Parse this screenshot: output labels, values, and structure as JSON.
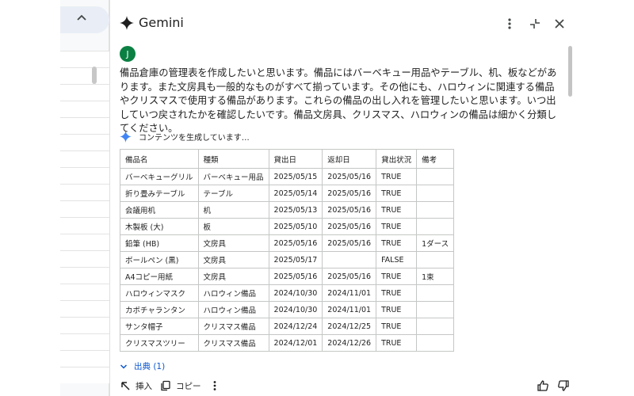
{
  "header": {
    "title": "Gemini",
    "icons": [
      "gemini-sparkle-icon",
      "more-vert-icon",
      "collapse-icon",
      "close-icon"
    ]
  },
  "user": {
    "avatar_letter": "J"
  },
  "prompt": {
    "text": "備品倉庫の管理表を作成したいと思います。備品にはバーベキュー用品やテーブル、机、板などがあります。また文房具も一般的なものがすべて揃っています。その他にも、ハロウィンに関連する備品やクリスマスで使用する備品があります。これらの備品の出し入れを管理したいと思います。いつ出していつ戻されたかを確認したいです。備品文房具、クリスマス、ハロウィンの備品は細かく分類してください。"
  },
  "response": {
    "status": "コンテンツを生成しています…",
    "table": {
      "headers": [
        "備品名",
        "種類",
        "貸出日",
        "返却日",
        "貸出状況",
        "備考"
      ],
      "rows": [
        [
          "バーベキューグリル",
          "バーベキュー用品",
          "2025/05/15",
          "2025/05/16",
          "TRUE",
          ""
        ],
        [
          "折り畳みテーブル",
          "テーブル",
          "2025/05/14",
          "2025/05/16",
          "TRUE",
          ""
        ],
        [
          "会議用机",
          "机",
          "2025/05/13",
          "2025/05/16",
          "TRUE",
          ""
        ],
        [
          "木製板 (大)",
          "板",
          "2025/05/10",
          "2025/05/16",
          "TRUE",
          ""
        ],
        [
          "鉛筆 (HB)",
          "文房具",
          "2025/05/16",
          "2025/05/16",
          "TRUE",
          "1ダース"
        ],
        [
          "ボールペン (黒)",
          "文房具",
          "2025/05/17",
          "",
          "FALSE",
          ""
        ],
        [
          "A4コピー用紙",
          "文房具",
          "2025/05/16",
          "2025/05/16",
          "TRUE",
          "1束"
        ],
        [
          "ハロウィンマスク",
          "ハロウィン備品",
          "2024/10/30",
          "2024/11/01",
          "TRUE",
          ""
        ],
        [
          "カボチャランタン",
          "ハロウィン備品",
          "2024/10/30",
          "2024/11/01",
          "TRUE",
          ""
        ],
        [
          "サンタ帽子",
          "クリスマス備品",
          "2024/12/24",
          "2024/12/25",
          "TRUE",
          ""
        ],
        [
          "クリスマスツリー",
          "クリスマス備品",
          "2024/12/01",
          "2024/12/26",
          "TRUE",
          ""
        ]
      ]
    },
    "sources_label": "出典 (1)",
    "actions": {
      "insert": "挿入",
      "copy": "コピー"
    }
  },
  "colors": {
    "accent": "#0b57d0",
    "avatar": "#0b8043"
  }
}
